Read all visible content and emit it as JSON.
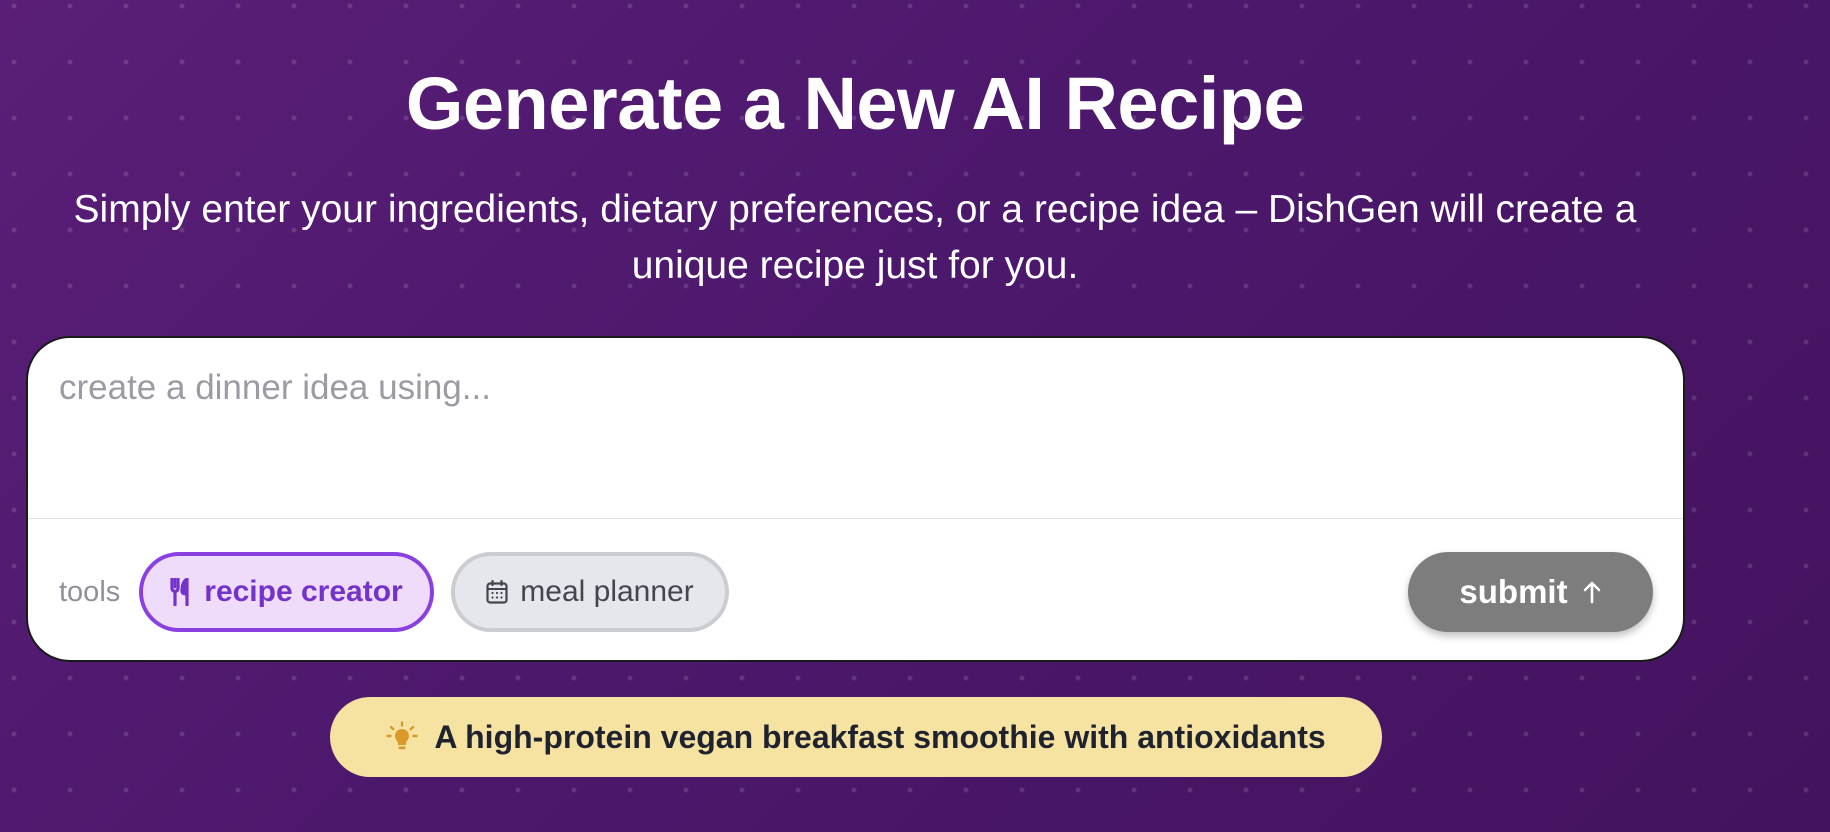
{
  "hero": {
    "title": "Generate a New AI Recipe",
    "subtitle": "Simply enter your ingredients, dietary preferences, or a recipe idea – DishGen will create a unique recipe just for you."
  },
  "prompt": {
    "placeholder": "create a dinner idea using...",
    "value": ""
  },
  "tools": {
    "label": "tools",
    "items": [
      {
        "label": "recipe creator",
        "icon": "fork-knife-icon",
        "selected": true
      },
      {
        "label": "meal planner",
        "icon": "calendar-icon",
        "selected": false
      }
    ]
  },
  "submit": {
    "label": "submit",
    "icon": "arrow-up-icon"
  },
  "suggestion": {
    "icon": "lightbulb-icon",
    "text": "A high-protein vegan breakfast smoothie with antioxidants"
  },
  "colors": {
    "background": "#4e1a6e",
    "accent": "#8a3fe0",
    "chip_selected_bg": "#efdcfb",
    "submit_bg": "#7d7d7d",
    "suggestion_bg": "#f6e2a1",
    "lightbulb": "#d99a2b"
  }
}
